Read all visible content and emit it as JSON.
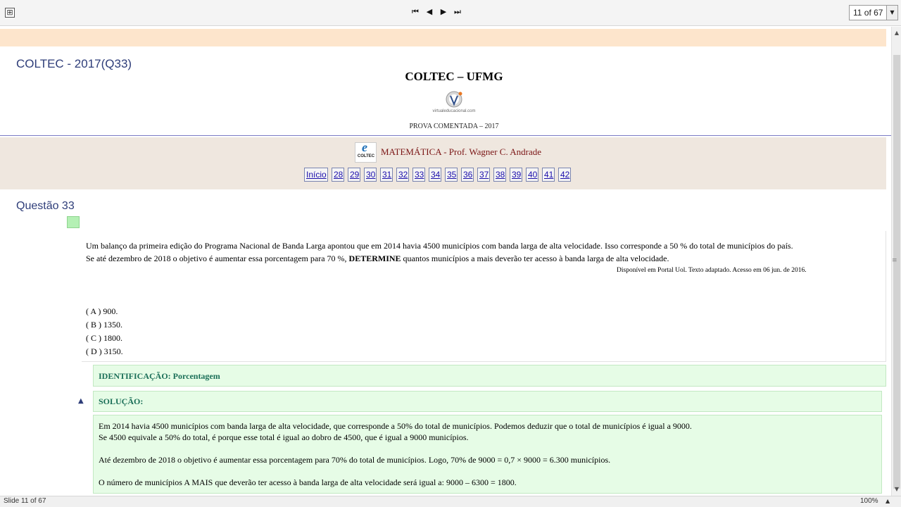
{
  "toolbar": {
    "expand_icon": "⊞",
    "nav": {
      "first": "⏮",
      "prev": "◀",
      "next": "▶",
      "last": "⏭"
    },
    "slide_counter": "11 of 67"
  },
  "slide": {
    "heading": "COLTEC - 2017(Q33)",
    "title": "COLTEC – UFMG",
    "logo_text": "virtualeducacional.com",
    "subtitle": "PROVA COMENTADA  –  2017",
    "subject_logo_text": "COLTEC",
    "subject_line": "MATEMÁTICA - Prof. Wagner C. Andrade",
    "pager": [
      "Início",
      "28",
      "29",
      "30",
      "31",
      "32",
      "33",
      "34",
      "35",
      "36",
      "37",
      "38",
      "39",
      "40",
      "41",
      "42"
    ],
    "question_title": "Questão 33",
    "question": {
      "line1": "Um balanço da primeira edição do Programa Nacional  de Banda Larga apontou que em 2014 havia 4500 municípios com banda larga de alta velocidade. Isso corresponde a 50 % do total de municípios do país.",
      "line2_a": "Se  até dezembro de 2018 o objetivo é aumentar essa porcentagem para 70 %,  ",
      "line2_bold": "DETERMINE",
      "line2_b": " quantos municípios a mais deverão ter acesso à banda larga de alta velocidade.",
      "source": "Disponível em Portal Uol. Texto adaptado. Acesso em 06 jun. de 2016."
    },
    "options": [
      "( A )  900.",
      "( B )  1350.",
      "( C )  1800.",
      "( D )  3150."
    ],
    "identification": "IDENTIFICAÇÃO:  Porcentagem",
    "solution_heading": "SOLUÇÃO:",
    "solution": {
      "p1": "Em 2014 havia 4500 municípios com banda larga de alta velocidade, que corresponde a 50% do total de municípios. Podemos deduzir que o total de municípios é igual a 9000.",
      "p2": "Se 4500 equivale a 50% do total, é porque esse total é igual ao dobro de 4500, que é igual a 9000 municípios.",
      "p3": "Até dezembro de 2018 o objetivo é aumentar essa porcentagem para 70% do total de municípios. Logo, 70% de 9000 = 0,7 × 9000 = 6.300 municípios.",
      "p4": "O número de municípios A MAIS que deverão ter acesso à banda larga de alta velocidade será igual a:  9000 – 6300 = 1800."
    }
  },
  "status": {
    "left": "Slide 11 of 67",
    "zoom": "100%"
  },
  "colors": {
    "heading_blue": "#2e3d79",
    "subject_red": "#7a1414",
    "solution_green": "#e6fce6",
    "peach": "#fde5cc"
  }
}
